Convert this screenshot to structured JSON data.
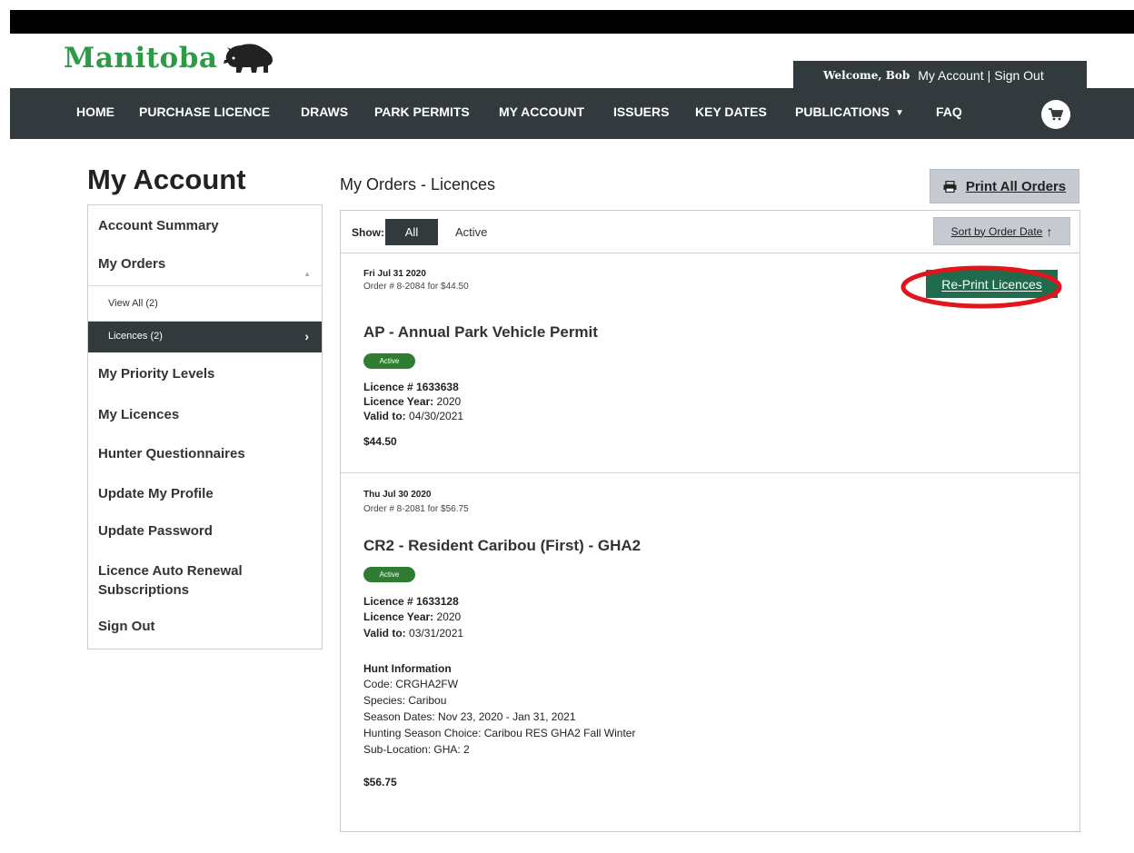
{
  "brand": {
    "logo_text": "Manitoba"
  },
  "header": {
    "welcome": "Welcome, Bob",
    "my_account": "My Account",
    "separator": "|",
    "sign_out": "Sign Out"
  },
  "nav": {
    "items": [
      "HOME",
      "PURCHASE LICENCE",
      "DRAWS",
      "PARK PERMITS",
      "MY ACCOUNT",
      "ISSUERS",
      "KEY DATES",
      "PUBLICATIONS",
      "FAQ"
    ]
  },
  "sidebar": {
    "title": "My Account",
    "items": [
      {
        "label": "Account Summary"
      },
      {
        "label": "My Orders"
      },
      {
        "label": "View All (2)"
      },
      {
        "label": "Licences (2)"
      },
      {
        "label": "My Priority Levels"
      },
      {
        "label": "My Licences"
      },
      {
        "label": "Hunter Questionnaires"
      },
      {
        "label": "Update My Profile"
      },
      {
        "label": "Update Password"
      },
      {
        "label": "Licence Auto Renewal Subscriptions"
      },
      {
        "label": "Sign Out"
      }
    ]
  },
  "main": {
    "title": "My Orders - Licences",
    "print_all_label": "Print All Orders",
    "filter": {
      "show_label": "Show:",
      "all_label": "All",
      "active_label": "Active",
      "sort_label": "Sort by Order Date"
    },
    "reprint_label": "Re-Print Licences",
    "orders": [
      {
        "date": "Fri Jul 31 2020",
        "order_line": "Order # 8-2084 for $44.50",
        "title": "AP - Annual Park Vehicle Permit",
        "status": "Active",
        "licence_no": "Licence # 1633638",
        "licence_year_label": "Licence Year:",
        "licence_year": "2020",
        "valid_to_label": "Valid to:",
        "valid_to": "04/30/2021",
        "price": "$44.50"
      },
      {
        "date": "Thu Jul 30 2020",
        "order_line": "Order # 8-2081 for $56.75",
        "title": "CR2 - Resident Caribou (First) - GHA2",
        "status": "Active",
        "licence_no": "Licence # 1633128",
        "licence_year_label": "Licence Year:",
        "licence_year": "2020",
        "valid_to_label": "Valid to:",
        "valid_to": "03/31/2021",
        "hunt_heading": "Hunt Information",
        "hunt_lines": [
          "Code: CRGHA2FW",
          "Species: Caribou",
          "Season Dates: Nov 23, 2020 - Jan 31, 2021",
          "Hunting Season Choice: Caribou RES GHA2 Fall Winter",
          "Sub-Location: GHA: 2"
        ],
        "price": "$56.75"
      }
    ]
  },
  "colors": {
    "brand_green": "#2d9a46",
    "nav_bg": "#333a3e",
    "badge_green": "#2e7d32",
    "reprint_green": "#1f6b4b",
    "highlight_red": "#e0161c"
  }
}
